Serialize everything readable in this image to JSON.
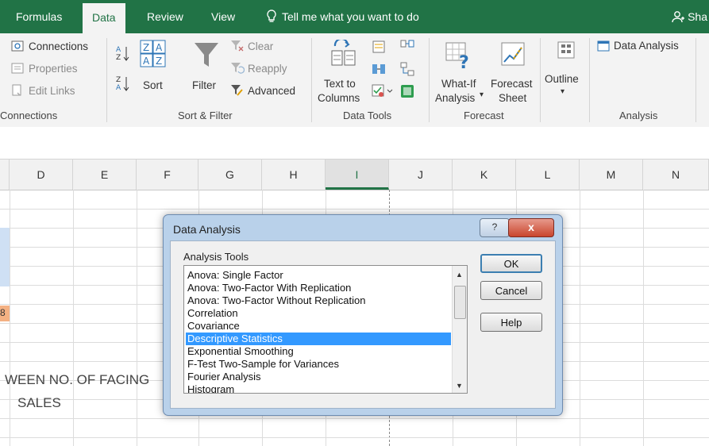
{
  "tabs": {
    "formulas": "Formulas",
    "data": "Data",
    "review": "Review",
    "view": "View",
    "tell_me": "Tell me what you want to do",
    "share": "Sha"
  },
  "ribbon": {
    "connections": {
      "connections": "Connections",
      "properties": "Properties",
      "edit_links": "Edit Links",
      "group_label": "Connections"
    },
    "sort_filter": {
      "sort": "Sort",
      "filter": "Filter",
      "clear": "Clear",
      "reapply": "Reapply",
      "advanced": "Advanced",
      "group_label": "Sort & Filter"
    },
    "data_tools": {
      "text_to_columns_line1": "Text to",
      "text_to_columns_line2": "Columns",
      "group_label": "Data Tools"
    },
    "forecast": {
      "what_if_line1": "What-If",
      "what_if_line2": "Analysis",
      "forecast_line1": "Forecast",
      "forecast_line2": "Sheet",
      "group_label": "Forecast"
    },
    "outline": {
      "label": "Outline"
    },
    "analysis": {
      "data_analysis": "Data Analysis",
      "group_label": "Analysis"
    }
  },
  "grid": {
    "columns": [
      "D",
      "E",
      "F",
      "G",
      "H",
      "I",
      "J",
      "K",
      "L",
      "M",
      "N"
    ],
    "selected_column": "I",
    "cell_text_line1": "WEEN NO. OF FACING",
    "cell_text_line2": "SALES",
    "cell_fragment": "8"
  },
  "dialog": {
    "title": "Data Analysis",
    "help_glyph": "?",
    "close_glyph": "x",
    "list_label": "Analysis Tools",
    "items": [
      "Anova: Single Factor",
      "Anova: Two-Factor With Replication",
      "Anova: Two-Factor Without Replication",
      "Correlation",
      "Covariance",
      "Descriptive Statistics",
      "Exponential Smoothing",
      "F-Test Two-Sample for Variances",
      "Fourier Analysis",
      "Histogram"
    ],
    "selected_item": "Descriptive Statistics",
    "ok": "OK",
    "cancel": "Cancel",
    "help": "Help"
  },
  "colors": {
    "excel_green": "#217346",
    "selection_blue": "#3399ff",
    "dialog_frame": "#b9d1ea",
    "close_red": "#c9452d"
  }
}
